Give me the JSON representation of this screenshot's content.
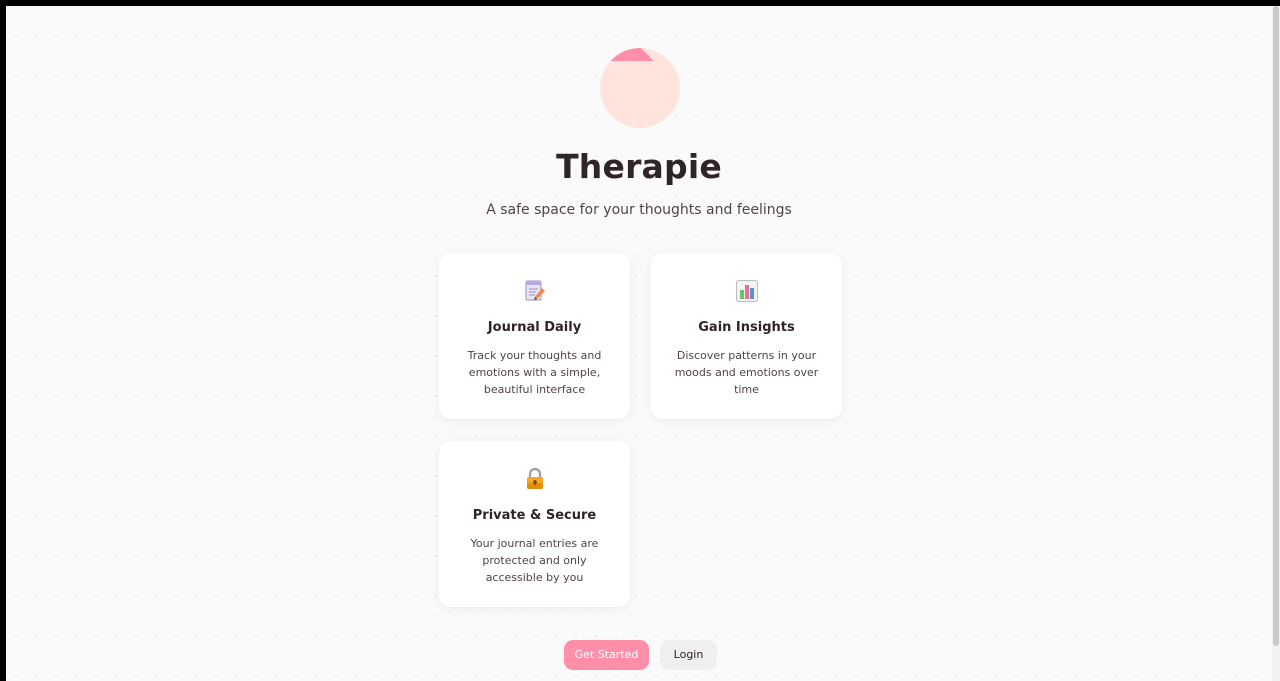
{
  "app": {
    "title": "Therapie",
    "tagline": "A safe space for your thoughts and feelings"
  },
  "features": [
    {
      "icon": "notepad-icon",
      "title": "Journal Daily",
      "description": "Track your thoughts and emotions with a simple, beautiful interface"
    },
    {
      "icon": "bar-chart-icon",
      "title": "Gain Insights",
      "description": "Discover patterns in your moods and emotions over time"
    },
    {
      "icon": "lock-icon",
      "title": "Private & Secure",
      "description": "Your journal entries are protected and only accessible by you"
    }
  ],
  "actions": {
    "primary_label": "Get Started",
    "secondary_label": "Login"
  },
  "colors": {
    "accent": "#ff8fa8",
    "logo_bg": "#ffe4dd",
    "text_dark": "#2f2426",
    "text_body": "#4f4446",
    "page_bg": "#fafafa"
  }
}
